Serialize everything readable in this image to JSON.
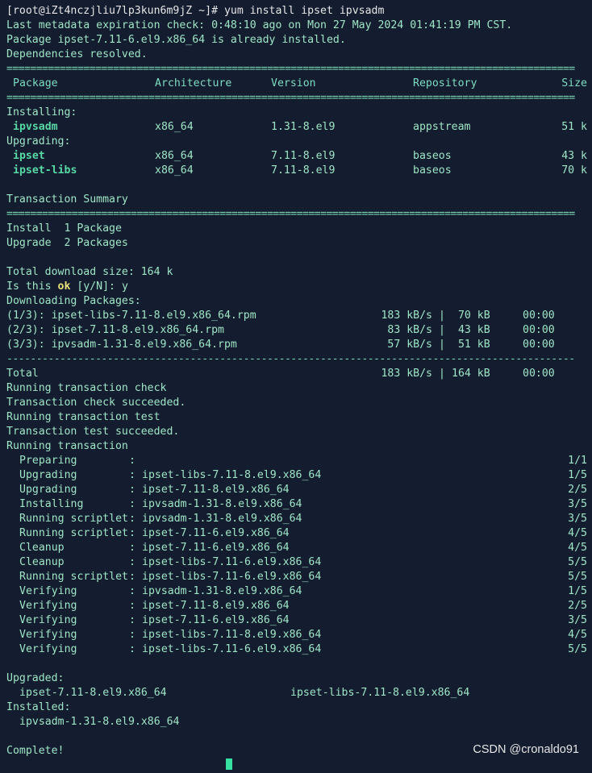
{
  "prompt": {
    "text": "[root@iZt4nczjliu7lp3kun6m9jZ ~]# yum install ipset ipvsadm"
  },
  "header_lines": [
    "Last metadata expiration check: 0:48:10 ago on Mon 27 May 2024 01:41:19 PM CST.",
    "Package ipset-7.11-6.el9.x86_64 is already installed.",
    "Dependencies resolved."
  ],
  "separator": "================================================================================================",
  "dash_separator": "------------------------------------------------------------------------------------------------",
  "table": {
    "headers": {
      "package": "Package",
      "arch": "Architecture",
      "version": "Version",
      "repo": "Repository",
      "size": "Size"
    },
    "installing_label": "Installing:",
    "upgrading_label": "Upgrading:",
    "installing": [
      {
        "package": "ipvsadm",
        "arch": "x86_64",
        "version": "1.31-8.el9",
        "repo": "appstream",
        "size": "51 k"
      }
    ],
    "upgrading": [
      {
        "package": "ipset",
        "arch": "x86_64",
        "version": "7.11-8.el9",
        "repo": "baseos",
        "size": "43 k"
      },
      {
        "package": "ipset-libs",
        "arch": "x86_64",
        "version": "7.11-8.el9",
        "repo": "baseos",
        "size": "70 k"
      }
    ]
  },
  "summary": {
    "title": "Transaction Summary",
    "install": "Install  1 Package",
    "upgrade": "Upgrade  2 Packages"
  },
  "download": {
    "total_size": "Total download size: 164 k",
    "confirm_pre": "Is this ",
    "confirm_ok": "ok",
    "confirm_post": " [y/N]: y",
    "downloading": "Downloading Packages:",
    "files": [
      {
        "name": "(1/3): ipset-libs-7.11-8.el9.x86_64.rpm",
        "rate": "183 kB/s",
        "size": " 70 kB",
        "time": "00:00"
      },
      {
        "name": "(2/3): ipset-7.11-8.el9.x86_64.rpm",
        "rate": "83 kB/s",
        "size": " 43 kB",
        "time": "00:00"
      },
      {
        "name": "(3/3): ipvsadm-1.31-8.el9.x86_64.rpm",
        "rate": "57 kB/s",
        "size": " 51 kB",
        "time": "00:00"
      }
    ],
    "total": {
      "name": "Total",
      "rate": "183 kB/s",
      "size": "164 kB",
      "time": "00:00"
    }
  },
  "transaction_lines": [
    "Running transaction check",
    "Transaction check succeeded.",
    "Running transaction test",
    "Transaction test succeeded.",
    "Running transaction"
  ],
  "steps": [
    {
      "action": "Preparing",
      "pkg": "",
      "count": "1/1"
    },
    {
      "action": "Upgrading",
      "pkg": "ipset-libs-7.11-8.el9.x86_64",
      "count": "1/5"
    },
    {
      "action": "Upgrading",
      "pkg": "ipset-7.11-8.el9.x86_64",
      "count": "2/5"
    },
    {
      "action": "Installing",
      "pkg": "ipvsadm-1.31-8.el9.x86_64",
      "count": "3/5"
    },
    {
      "action": "Running scriptlet",
      "pkg": "ipvsadm-1.31-8.el9.x86_64",
      "count": "3/5"
    },
    {
      "action": "Running scriptlet",
      "pkg": "ipset-7.11-6.el9.x86_64",
      "count": "4/5"
    },
    {
      "action": "Cleanup",
      "pkg": "ipset-7.11-6.el9.x86_64",
      "count": "4/5"
    },
    {
      "action": "Cleanup",
      "pkg": "ipset-libs-7.11-6.el9.x86_64",
      "count": "5/5"
    },
    {
      "action": "Running scriptlet",
      "pkg": "ipset-libs-7.11-6.el9.x86_64",
      "count": "5/5"
    },
    {
      "action": "Verifying",
      "pkg": "ipvsadm-1.31-8.el9.x86_64",
      "count": "1/5"
    },
    {
      "action": "Verifying",
      "pkg": "ipset-7.11-8.el9.x86_64",
      "count": "2/5"
    },
    {
      "action": "Verifying",
      "pkg": "ipset-7.11-6.el9.x86_64",
      "count": "3/5"
    },
    {
      "action": "Verifying",
      "pkg": "ipset-libs-7.11-8.el9.x86_64",
      "count": "4/5"
    },
    {
      "action": "Verifying",
      "pkg": "ipset-libs-7.11-6.el9.x86_64",
      "count": "5/5"
    }
  ],
  "result": {
    "upgraded_label": "Upgraded:",
    "upgraded": [
      "ipset-7.11-8.el9.x86_64",
      "ipset-libs-7.11-8.el9.x86_64"
    ],
    "installed_label": "Installed:",
    "installed": [
      "ipvsadm-1.31-8.el9.x86_64"
    ],
    "complete": "Complete!"
  },
  "watermark": "CSDN @cronaldo91",
  "colors": {
    "background": "#141c2f",
    "text": "#c3e88d",
    "package_name": "#58d9a5",
    "highlight_ok": "#e8e07a",
    "cursor": "#35e0a0"
  }
}
